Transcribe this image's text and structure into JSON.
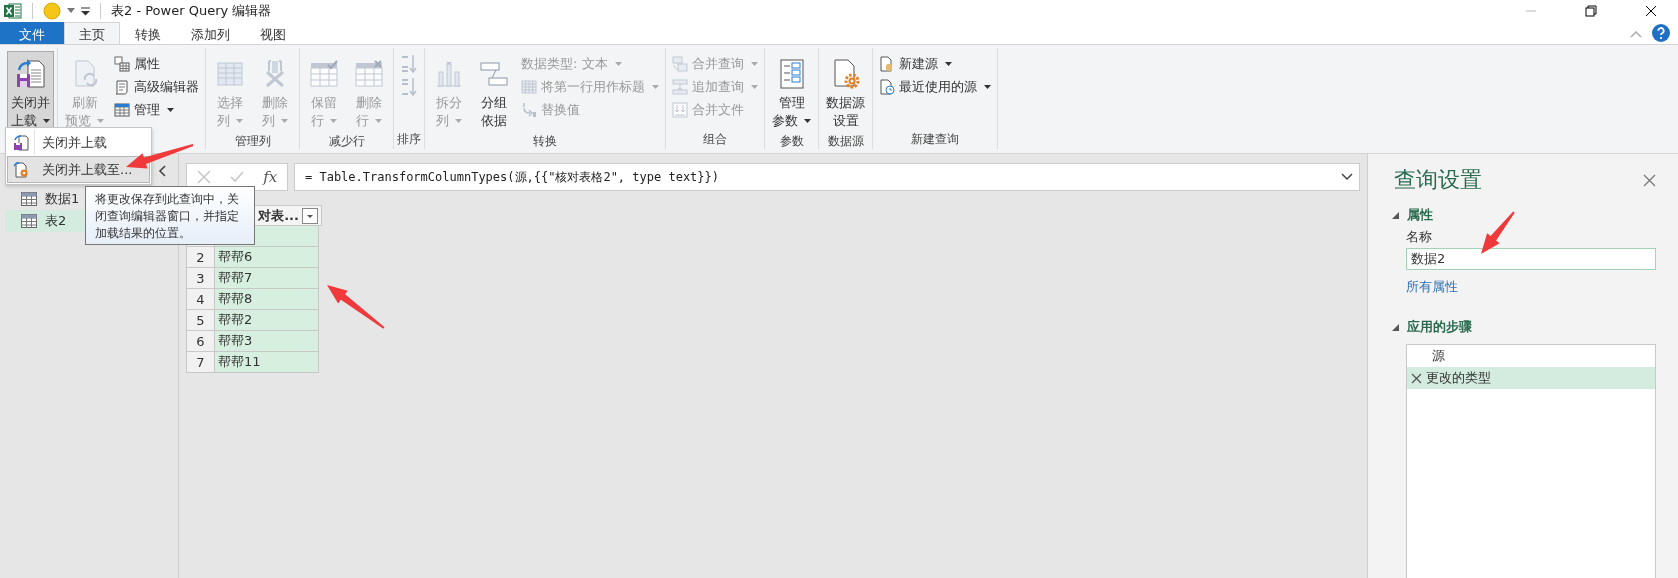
{
  "window": {
    "title": "表2 - Power Query 编辑器"
  },
  "tabs": [
    {
      "label": "文件",
      "kind": "file",
      "selected": false
    },
    {
      "label": "主页",
      "kind": "tab",
      "selected": true
    },
    {
      "label": "转换",
      "kind": "tab",
      "selected": false
    },
    {
      "label": "添加列",
      "kind": "tab",
      "selected": false
    },
    {
      "label": "视图",
      "kind": "tab",
      "selected": false
    }
  ],
  "ribbon": {
    "groups": [
      {
        "items": [
          {
            "kind": "large",
            "lines": [
              "关闭并",
              "上载"
            ],
            "dropdown": true,
            "disabled": false,
            "pressed": true
          }
        ]
      },
      {
        "items": [
          {
            "kind": "large",
            "lines": [
              "刷新",
              "预览"
            ],
            "dropdown": true,
            "disabled": true,
            "pressed": false
          },
          {
            "kind": "stack",
            "items": [
              {
                "label": "属性",
                "dropdown": false,
                "disabled": false
              },
              {
                "label": "高级编辑器",
                "dropdown": false,
                "disabled": false
              },
              {
                "label": "管理",
                "dropdown": true,
                "disabled": false
              }
            ]
          }
        ]
      },
      {
        "label": "管理列",
        "items": [
          {
            "kind": "large",
            "lines": [
              "选择",
              "列"
            ],
            "dropdown": true,
            "disabled": true,
            "pressed": false
          },
          {
            "kind": "large",
            "lines": [
              "删除",
              "列"
            ],
            "dropdown": true,
            "disabled": true,
            "pressed": false
          }
        ]
      },
      {
        "label": "减少行",
        "items": [
          {
            "kind": "large",
            "lines": [
              "保留",
              "行"
            ],
            "dropdown": true,
            "disabled": true,
            "pressed": false
          },
          {
            "kind": "large",
            "lines": [
              "删除",
              "行"
            ],
            "dropdown": true,
            "disabled": true,
            "pressed": false
          }
        ]
      },
      {
        "label": "排序",
        "items": [
          {
            "kind": "stack",
            "items": [
              {
                "dropdown": false,
                "disabled": true
              },
              {
                "dropdown": false,
                "disabled": true
              }
            ]
          }
        ]
      },
      {
        "label": "转换",
        "items": [
          {
            "kind": "large",
            "lines": [
              "拆分",
              "列"
            ],
            "dropdown": true,
            "disabled": true,
            "pressed": false
          },
          {
            "kind": "large",
            "lines": [
              "分组",
              "依据"
            ],
            "dropdown": false,
            "disabled": false,
            "pressed": false
          },
          {
            "kind": "stack",
            "items": [
              {
                "label": "数据类型: 文本",
                "dropdown": true,
                "disabled": true
              },
              {
                "label": "将第一行用作标题",
                "dropdown": true,
                "disabled": true
              },
              {
                "label": "替换值",
                "dropdown": false,
                "disabled": true
              }
            ]
          }
        ]
      },
      {
        "label": "组合",
        "items": [
          {
            "kind": "stack",
            "items": [
              {
                "label": "合并查询",
                "dropdown": true,
                "disabled": true
              },
              {
                "label": "追加查询",
                "dropdown": true,
                "disabled": true
              },
              {
                "label": "合并文件",
                "dropdown": false,
                "disabled": true
              }
            ]
          }
        ]
      },
      {
        "label": "参数",
        "items": [
          {
            "kind": "large",
            "lines": [
              "管理",
              "参数"
            ],
            "dropdown": true,
            "disabled": false,
            "pressed": false
          }
        ]
      },
      {
        "label": "数据源",
        "items": [
          {
            "kind": "large",
            "lines": [
              "数据源",
              "设置"
            ],
            "dropdown": false,
            "disabled": false,
            "pressed": false
          }
        ]
      },
      {
        "label": "新建查询",
        "items": [
          {
            "kind": "stack",
            "items": [
              {
                "label": "新建源",
                "dropdown": true,
                "disabled": false
              },
              {
                "label": "最近使用的源",
                "dropdown": true,
                "disabled": false
              }
            ]
          }
        ]
      }
    ]
  },
  "load_menu": [
    {
      "label": "关闭并上载",
      "selected": false
    },
    {
      "label": "关闭并上载至...",
      "selected": true
    }
  ],
  "tooltip": "将更改保存到此查询中，关闭查询编辑器窗口，并指定加载结果的位置。",
  "queries": [
    {
      "name": "数据1",
      "selected": false
    },
    {
      "name": "表2",
      "selected": true
    }
  ],
  "formula_bar": {
    "fx": "fx",
    "formula": "= Table.TransformColumnTypes(源,{{\"核对表格2\", type text}})"
  },
  "table": {
    "column": "对表...",
    "rows": [
      {
        "num": "2",
        "value": "帮帮6"
      },
      {
        "num": "3",
        "value": "帮帮7"
      },
      {
        "num": "4",
        "value": "帮帮8"
      },
      {
        "num": "5",
        "value": "帮帮2"
      },
      {
        "num": "6",
        "value": "帮帮3"
      },
      {
        "num": "7",
        "value": "帮帮11"
      }
    ]
  },
  "settings": {
    "title": "查询设置",
    "properties": {
      "heading": "属性",
      "expanded": true,
      "name_label": "名称",
      "name_value": "数据2",
      "all_link": "所有属性"
    },
    "steps": {
      "heading": "应用的步骤",
      "expanded": true,
      "items": [
        {
          "label": "源",
          "selected": false
        },
        {
          "label": "更改的类型",
          "selected": true
        }
      ]
    }
  }
}
